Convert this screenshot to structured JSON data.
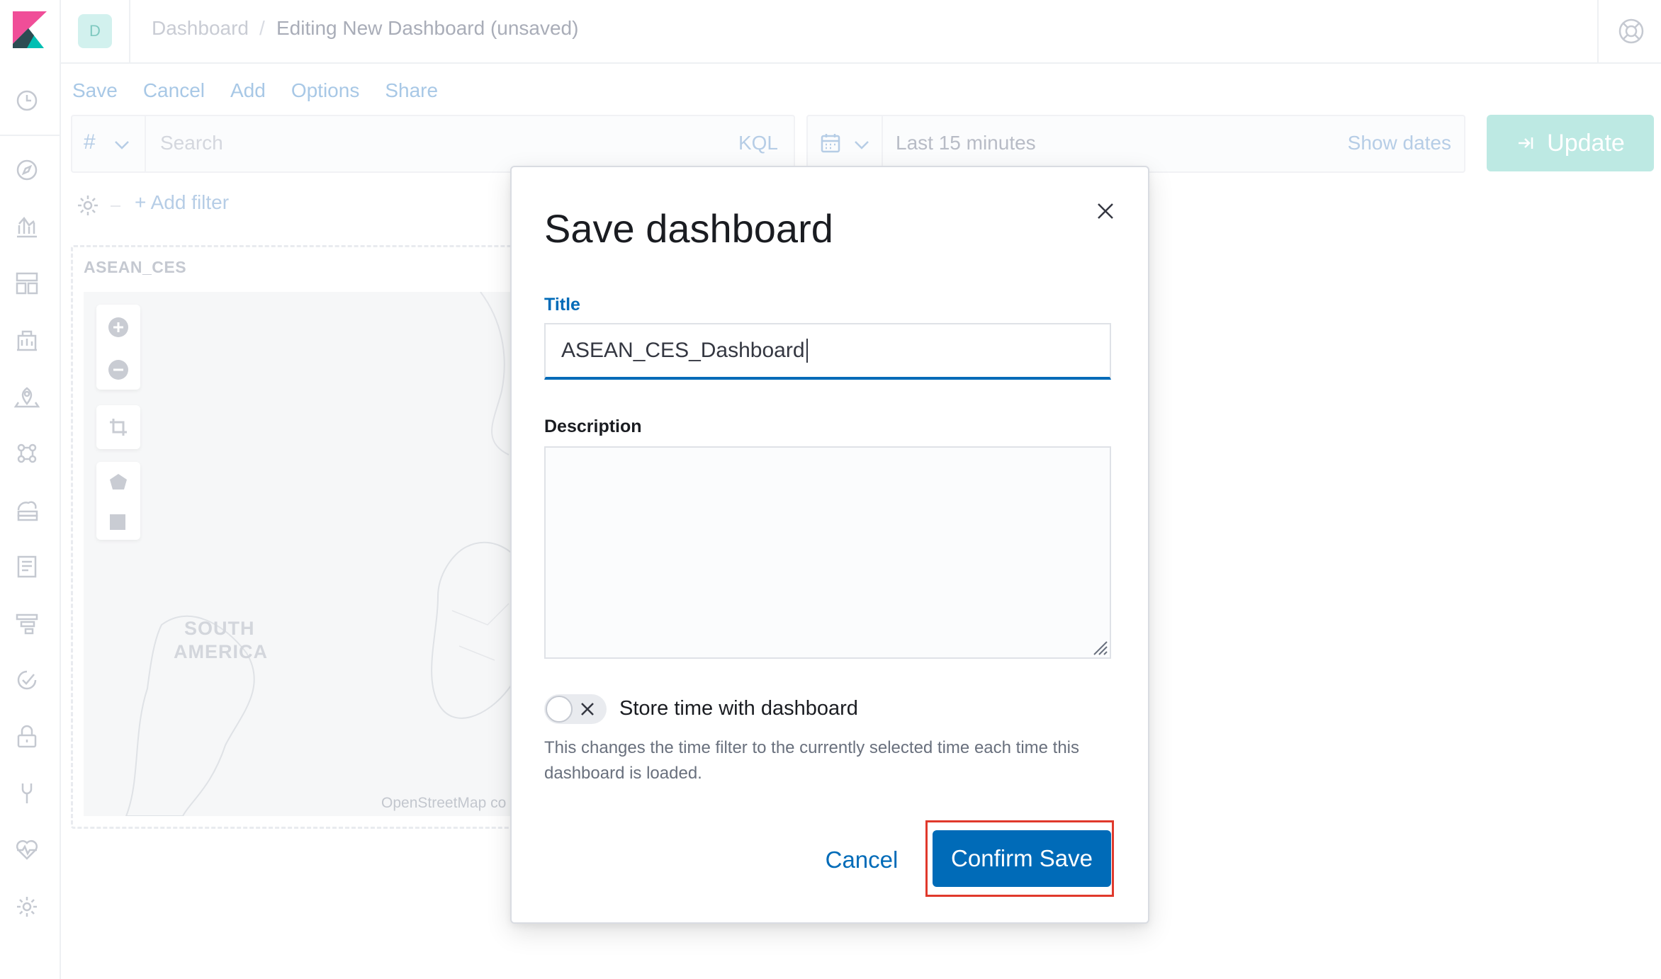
{
  "header": {
    "space_initial": "D",
    "breadcrumb_root": "Dashboard",
    "breadcrumb_separator": "/",
    "breadcrumb_current": "Editing New Dashboard (unsaved)"
  },
  "sidebar": {
    "icons": [
      "clock-icon",
      "compass-icon",
      "visualize-icon",
      "dashboard-icon",
      "canvas-icon",
      "maps-icon",
      "ml-icon",
      "infrastructure-icon",
      "logs-icon",
      "apm-icon",
      "uptime-icon",
      "siem-icon",
      "dev-tools-icon",
      "monitoring-icon",
      "management-icon"
    ]
  },
  "topnav": {
    "save": "Save",
    "cancel": "Cancel",
    "add": "Add",
    "options": "Options",
    "share": "Share"
  },
  "querybar": {
    "lang_symbol": "#",
    "search_placeholder": "Search",
    "kql": "KQL"
  },
  "timebar": {
    "range": "Last 15 minutes",
    "show_dates": "Show dates"
  },
  "update_button": {
    "label": "Update"
  },
  "filter": {
    "add_filter": "+ Add filter"
  },
  "panel": {
    "title": "ASEAN_CES",
    "map_label_line1": "SOUTH",
    "map_label_line2": "AMERICA",
    "attribution": "OpenStreetMap co"
  },
  "modal": {
    "title": "Save dashboard",
    "title_label": "Title",
    "title_value": "ASEAN_CES_Dashboard",
    "description_label": "Description",
    "description_value": "",
    "toggle_label": "Store time with dashboard",
    "toggle_help": "This changes the time filter to the currently selected time each time this dashboard is loaded.",
    "cancel_label": "Cancel",
    "confirm_label": "Confirm Save"
  },
  "colors": {
    "primary": "#006bb8",
    "highlight": "#e0392c",
    "update_disabled": "#bde9e3"
  }
}
